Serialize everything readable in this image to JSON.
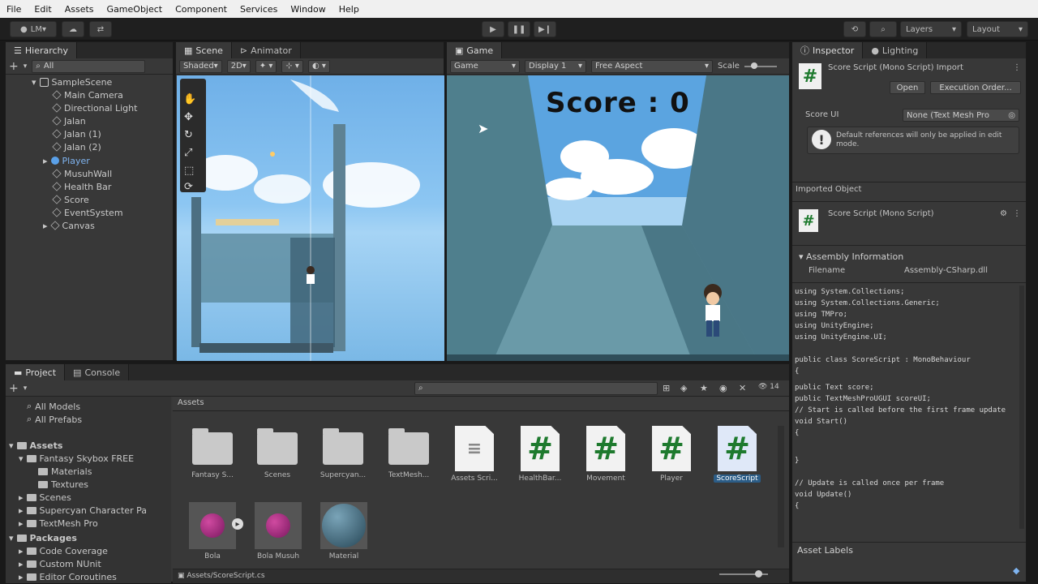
{
  "menu": [
    "File",
    "Edit",
    "Assets",
    "GameObject",
    "Component",
    "Services",
    "Window",
    "Help"
  ],
  "toolbar": {
    "account": "LM",
    "layers": "Layers",
    "layout": "Layout"
  },
  "hierarchy": {
    "tab": "Hierarchy",
    "search_placeholder": "All",
    "scene": "SampleScene",
    "items": [
      "Main Camera",
      "Directional Light",
      "Jalan",
      "Jalan (1)",
      "Jalan (2)",
      "Player",
      "MusuhWall",
      "Health Bar",
      "Score",
      "EventSystem",
      "Canvas"
    ]
  },
  "scene_view": {
    "tabs": [
      "Scene",
      "Animator"
    ],
    "shading": "Shaded",
    "mode": "2D"
  },
  "game_view": {
    "tab": "Game",
    "display": "Game",
    "display_num": "Display 1",
    "aspect": "Free Aspect",
    "scale": "Scale",
    "score_text": "Score : 0"
  },
  "inspector": {
    "tabs": [
      "Inspector",
      "Lighting"
    ],
    "title": "Score Script (Mono Script) Import",
    "open_btn": "Open",
    "execution_btn": "Execution Order...",
    "score_ui_label": "Score UI",
    "score_ui_value": "None (Text Mesh Pro",
    "warning": "Default references will only be applied in edit mode.",
    "imported_object": "Imported Object",
    "script_title": "Score Script (Mono Script)",
    "assembly_info": "Assembly Information",
    "filename_label": "Filename",
    "filename_value": "Assembly-CSharp.dll",
    "code": [
      "using System.Collections;",
      "using System.Collections.Generic;",
      "using TMPro;",
      "using UnityEngine;",
      "using UnityEngine.UI;",
      "",
      "public class ScoreScript : MonoBehaviour",
      "{",
      "    public Text score;",
      "    public TextMeshProUGUI scoreUI;",
      "    // Start is called before the first frame update",
      "    void Start()",
      "    {",
      "",
      "    }",
      "",
      "    // Update is called once per frame",
      "    void Update()",
      "    {"
    ],
    "asset_labels": "Asset Labels"
  },
  "project": {
    "tabs": [
      "Project",
      "Console"
    ],
    "favorites": [
      "All Models",
      "All Prefabs"
    ],
    "tree": [
      {
        "label": "Assets",
        "indent": 0
      },
      {
        "label": "Fantasy Skybox FREE",
        "indent": 1
      },
      {
        "label": "Materials",
        "indent": 2
      },
      {
        "label": "Textures",
        "indent": 2
      },
      {
        "label": "Scenes",
        "indent": 1
      },
      {
        "label": "Supercyan Character Pa",
        "indent": 1
      },
      {
        "label": "TextMesh Pro",
        "indent": 1
      },
      {
        "label": "Packages",
        "indent": 0
      },
      {
        "label": "Code Coverage",
        "indent": 1
      },
      {
        "label": "Custom NUnit",
        "indent": 1
      },
      {
        "label": "Editor Coroutines",
        "indent": 1
      }
    ],
    "breadcrumb": "Assets",
    "assets": [
      {
        "type": "folder",
        "label": "Fantasy S..."
      },
      {
        "type": "folder",
        "label": "Scenes"
      },
      {
        "type": "folder",
        "label": "Supercyan..."
      },
      {
        "type": "folder",
        "label": "TextMesh..."
      },
      {
        "type": "doc",
        "label": "Assets Scri..."
      },
      {
        "type": "script",
        "label": "HealthBar..."
      },
      {
        "type": "script",
        "label": "Movement"
      },
      {
        "type": "script",
        "label": "Player"
      },
      {
        "type": "script",
        "label": "ScoreScript",
        "selected": true
      },
      {
        "type": "material",
        "label": "Bola"
      },
      {
        "type": "material",
        "label": "Bola Musuh"
      },
      {
        "type": "sphere",
        "label": "Material"
      }
    ],
    "status_path": "Assets/ScoreScript.cs",
    "count": "14"
  }
}
